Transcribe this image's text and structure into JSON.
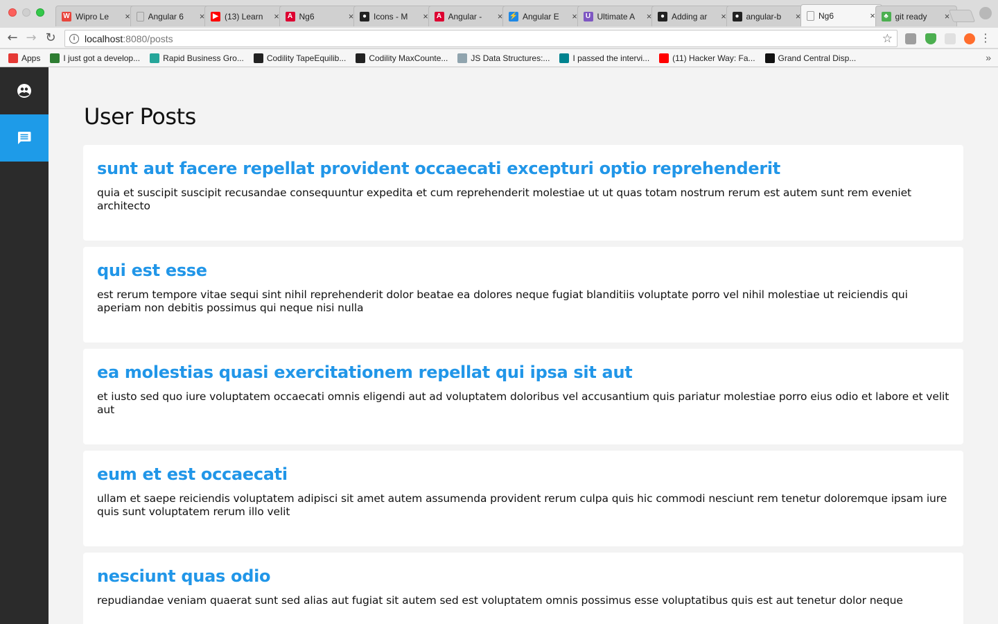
{
  "browser": {
    "tabs": [
      {
        "label": "Wipro Le",
        "color": "#e8453c",
        "glyph": "W"
      },
      {
        "label": "Angular 6",
        "color": "#9e9e9e",
        "glyph": ""
      },
      {
        "label": "(13) Learn",
        "color": "#ff0000",
        "glyph": "▶"
      },
      {
        "label": "Ng6",
        "color": "#dd0031",
        "glyph": "A"
      },
      {
        "label": "Icons - M",
        "color": "#222222",
        "glyph": "●"
      },
      {
        "label": "Angular -",
        "color": "#dd0031",
        "glyph": "A"
      },
      {
        "label": "Angular E",
        "color": "#1e88e5",
        "glyph": "⚡"
      },
      {
        "label": "Ultimate A",
        "color": "#7e57c2",
        "glyph": "U"
      },
      {
        "label": "Adding ar",
        "color": "#222222",
        "glyph": "●"
      },
      {
        "label": "angular-b",
        "color": "#222222",
        "glyph": "●"
      },
      {
        "label": "Ng6",
        "color": "#9e9e9e",
        "glyph": "",
        "active": true
      },
      {
        "label": "git ready",
        "color": "#4caf50",
        "glyph": "♣"
      }
    ],
    "url_host": "localhost",
    "url_path": ":8080/posts",
    "bookmarks": [
      {
        "label": "Apps",
        "color": "#e53935"
      },
      {
        "label": "I just got a develop...",
        "color": "#2e7d32"
      },
      {
        "label": "Rapid Business Gro...",
        "color": "#26a69a"
      },
      {
        "label": "Codility TapeEquilib...",
        "color": "#222222"
      },
      {
        "label": "Codility MaxCounte...",
        "color": "#222222"
      },
      {
        "label": "JS Data Structures:...",
        "color": "#90a4ae"
      },
      {
        "label": "I passed the intervi...",
        "color": "#00838f"
      },
      {
        "label": "(11) Hacker Way: Fa...",
        "color": "#ff0000"
      },
      {
        "label": "Grand Central Disp...",
        "color": "#111111"
      }
    ],
    "more": "»"
  },
  "sidebar": {
    "items": [
      {
        "icon": "users-icon",
        "active": false
      },
      {
        "icon": "message-icon",
        "active": true
      }
    ]
  },
  "page": {
    "title": "User Posts"
  },
  "posts": [
    {
      "title": "sunt aut facere repellat provident occaecati excepturi optio reprehenderit",
      "body": "quia et suscipit suscipit recusandae consequuntur expedita et cum reprehenderit molestiae ut ut quas totam nostrum rerum est autem sunt rem eveniet architecto"
    },
    {
      "title": "qui est esse",
      "body": "est rerum tempore vitae sequi sint nihil reprehenderit dolor beatae ea dolores neque fugiat blanditiis voluptate porro vel nihil molestiae ut reiciendis qui aperiam non debitis possimus qui neque nisi nulla"
    },
    {
      "title": "ea molestias quasi exercitationem repellat qui ipsa sit aut",
      "body": "et iusto sed quo iure voluptatem occaecati omnis eligendi aut ad voluptatem doloribus vel accusantium quis pariatur molestiae porro eius odio et labore et velit aut"
    },
    {
      "title": "eum et est occaecati",
      "body": "ullam et saepe reiciendis voluptatem adipisci sit amet autem assumenda provident rerum culpa quis hic commodi nesciunt rem tenetur doloremque ipsam iure quis sunt voluptatem rerum illo velit"
    },
    {
      "title": "nesciunt quas odio",
      "body": "repudiandae veniam quaerat sunt sed alias aut fugiat sit autem sed est voluptatem omnis possimus esse voluptatibus quis est aut tenetur dolor neque"
    }
  ]
}
